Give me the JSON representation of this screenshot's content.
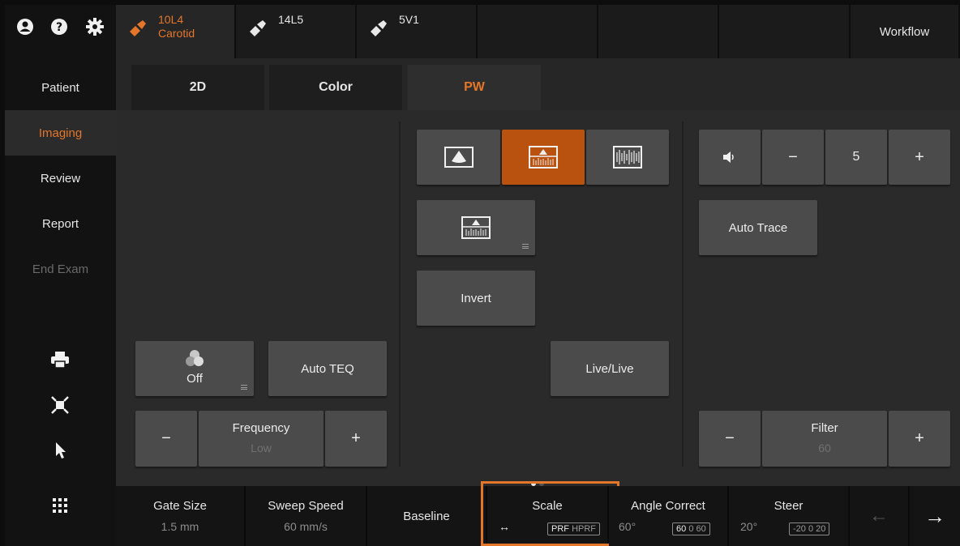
{
  "colors": {
    "accent": "#e4762a",
    "selected": "#b9520f"
  },
  "sidebar": {
    "icons": [
      "user-icon",
      "help-icon",
      "gear-icon"
    ],
    "nav": [
      {
        "label": "Patient"
      },
      {
        "label": "Imaging"
      },
      {
        "label": "Review"
      },
      {
        "label": "Report"
      },
      {
        "label": "End Exam"
      }
    ],
    "tool_icons": [
      "printer-icon",
      "fullscreen-icon",
      "pointer-icon",
      "grid-menu-icon"
    ]
  },
  "probes": [
    {
      "line1": "10L4",
      "line2": "Carotid"
    },
    {
      "line1": "14L5",
      "line2": ""
    },
    {
      "line1": "5V1",
      "line2": ""
    }
  ],
  "workflow_label": "Workflow",
  "mode_tabs": [
    {
      "label": "2D"
    },
    {
      "label": "Color"
    },
    {
      "label": "PW"
    }
  ],
  "controls": {
    "teq_state": "Off",
    "auto_teq": "Auto TEQ",
    "frequency": {
      "label": "Frequency",
      "value": "Low",
      "minus": "−",
      "plus": "+"
    },
    "invert": "Invert",
    "live_live": "Live/Live",
    "volume": {
      "value": "5",
      "minus": "−",
      "plus": "+"
    },
    "auto_trace": "Auto Trace",
    "filter": {
      "label": "Filter",
      "value": "60",
      "minus": "−",
      "plus": "+"
    }
  },
  "bottom": {
    "gate_size": {
      "label": "Gate Size",
      "value": "1.5 mm"
    },
    "sweep_speed": {
      "label": "Sweep Speed",
      "value": "60 mm/s"
    },
    "baseline": {
      "label": "Baseline"
    },
    "scale": {
      "label": "Scale",
      "arrows": "↔",
      "prf": "PRF",
      "hprf": "HPRF"
    },
    "angle_correct": {
      "label": "Angle Correct",
      "value": "60°",
      "pill_sel": "60",
      "pill_rest": "0 60"
    },
    "steer": {
      "label": "Steer",
      "value": "20°",
      "pill_a": "-20",
      "pill_b": "0",
      "pill_c": "20"
    },
    "prev": "←",
    "next": "→"
  }
}
